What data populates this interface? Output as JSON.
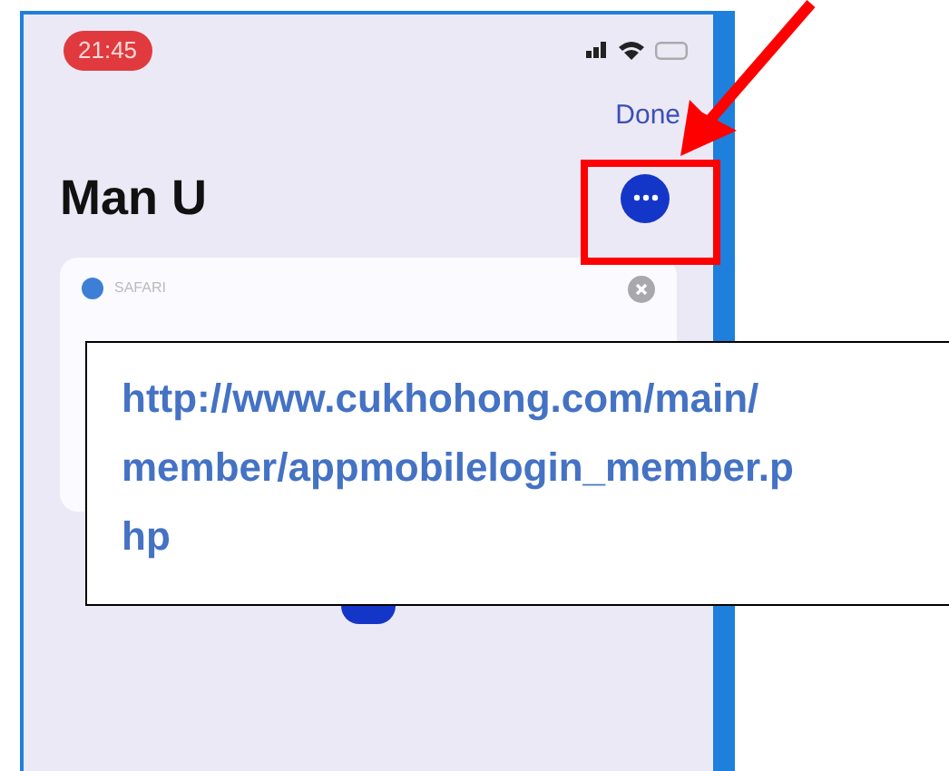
{
  "status_bar": {
    "time": "21:45"
  },
  "nav": {
    "done": "Done"
  },
  "title": "Man U",
  "card": {
    "app_label": "SAFARI"
  },
  "annotation": {
    "lines": [
      "http://www.cukhohong.com/main/",
      "member/appmobilelogin_member.p",
      "hp"
    ]
  }
}
